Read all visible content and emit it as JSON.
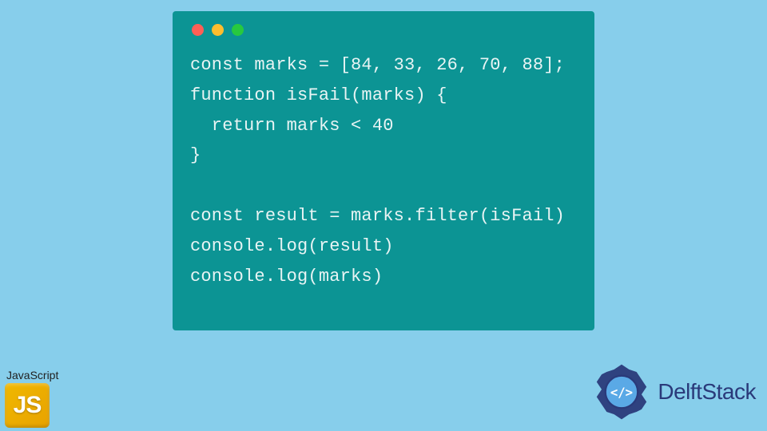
{
  "code": {
    "lines": [
      "const marks = [84, 33, 26, 70, 88];",
      "function isFail(marks) {",
      "  return marks < 40",
      "}",
      "",
      "const result = marks.filter(isFail)",
      "console.log(result)",
      "console.log(marks)"
    ]
  },
  "js_badge": {
    "label": "JavaScript",
    "icon_text": "JS"
  },
  "brand": {
    "name": "DelftStack"
  },
  "colors": {
    "page_bg": "#87ceeb",
    "window_bg": "#0c9494",
    "code_text": "#e8f4f4",
    "dot_red": "#ff5f56",
    "dot_yellow": "#ffbd2e",
    "dot_green": "#27c93f",
    "js_icon": "#f0b800",
    "brand_text": "#2a3a7a"
  }
}
